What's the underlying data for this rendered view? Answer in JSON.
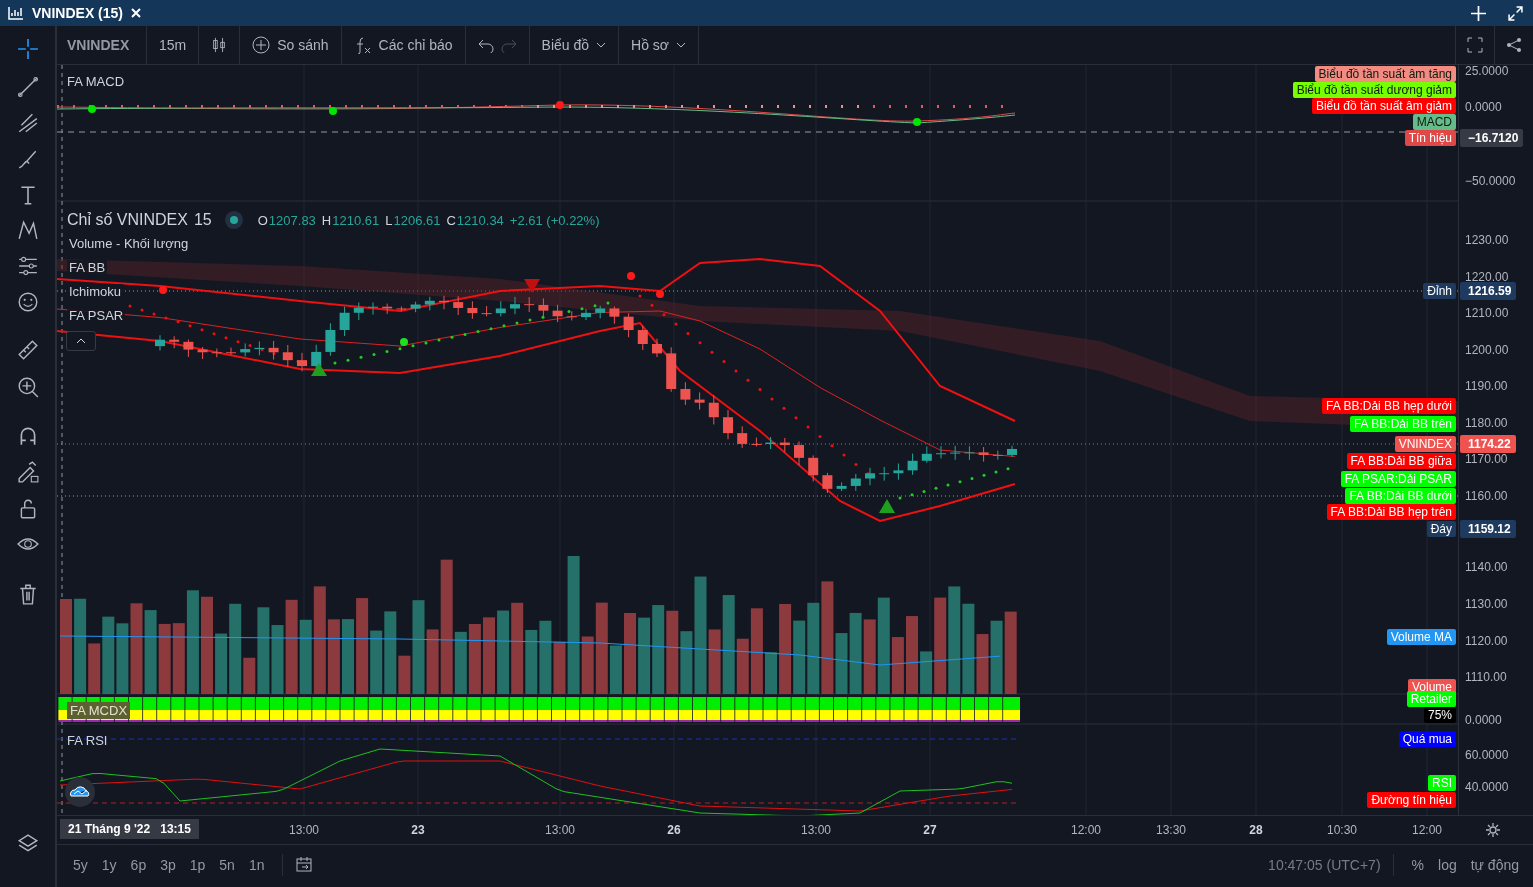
{
  "tab": {
    "title": "VNINDEX (15)"
  },
  "toolbar": {
    "symbol": "VNINDEX",
    "interval": "15m",
    "compare": "So sánh",
    "indicators": "Các chỉ báo",
    "chart_menu": "Biểu đồ",
    "profile_menu": "Hồ sơ"
  },
  "macd_pane": {
    "title": "FA MACD",
    "axis_ticks": [
      "25.0000",
      "0.0000",
      "−50.0000"
    ],
    "tags": [
      {
        "label": "Biểu đồ tần suất âm tăng",
        "color": "#f28b82"
      },
      {
        "label": "Biểu đồ tần suất dương giảm",
        "color": "#76ff03"
      },
      {
        "label": "Biểu đồ tần suất âm giảm",
        "color": "#ff0000"
      },
      {
        "label": "MACD",
        "color": "#66bb8a"
      },
      {
        "label": "Tín hiệu",
        "color": "#e04848"
      }
    ],
    "axis_labels": [
      {
        "label": "−16.7120",
        "color": "#363a45"
      }
    ]
  },
  "main_pane": {
    "symbol": "Chỉ số VNINDEX",
    "interval": "15",
    "ohlc": [
      {
        "key": "O",
        "value": "1207.83"
      },
      {
        "key": "H",
        "value": "1210.61"
      },
      {
        "key": "L",
        "value": "1206.61"
      },
      {
        "key": "C",
        "value": "1210.34"
      }
    ],
    "change": "+2.61 (+0.22%)",
    "indicators": [
      "Volume - Khối lượng",
      "FA BB",
      "Ichimoku",
      "FA PSAR"
    ],
    "axis_ticks": [
      "1230.00",
      "1220.00",
      "1210.00",
      "1200.00",
      "1190.00",
      "1180.00",
      "1170.00",
      "1160.00",
      "1140.00",
      "1130.00",
      "1120.00",
      "1110.00"
    ],
    "tags": [
      {
        "label": "Đỉnh",
        "color": "#1e3a5f"
      },
      {
        "label": "FA BB:Dải BB hẹp dưới",
        "color": "#ff0000"
      },
      {
        "label": "FA BB:Dải BB trên",
        "color": "#00ff00"
      },
      {
        "label": "VNINDEX",
        "color": "#ef5350"
      },
      {
        "label": "FA BB:Dải BB giữa",
        "color": "#ff0000"
      },
      {
        "label": "FA PSAR:Dải PSAR",
        "color": "#00ff00"
      },
      {
        "label": "FA BB:Dải BB dưới",
        "color": "#00ff00"
      },
      {
        "label": "FA BB:Dải BB hẹp trên",
        "color": "#ff0000"
      },
      {
        "label": "Đáy",
        "color": "#1e3a5f"
      },
      {
        "label": "Volume MA",
        "color": "#2196f3"
      },
      {
        "label": "Volume",
        "color": "#ef5350"
      }
    ],
    "axis_labels": [
      {
        "label": "1216.59",
        "color": "#1e3a5f"
      },
      {
        "label": "1174.22",
        "color": "#ef5350"
      },
      {
        "label": "1159.12",
        "color": "#1e3a5f"
      }
    ]
  },
  "mcdx_pane": {
    "title": "FA MCDX",
    "axis_ticks": [
      "0.0000"
    ],
    "tags": [
      {
        "label": "Retailer",
        "color": "#00ff00"
      },
      {
        "label": "75%",
        "color": "#000000"
      }
    ]
  },
  "rsi_pane": {
    "title": "FA RSI",
    "axis_ticks": [
      "60.0000",
      "40.0000"
    ],
    "tags": [
      {
        "label": "Quá mua",
        "color": "#0000ff"
      },
      {
        "label": "RSI",
        "color": "#00ff00"
      },
      {
        "label": "Đường tín hiệu",
        "color": "#ff0000"
      }
    ]
  },
  "time_axis": {
    "cursor_label": "21 Tháng 9 '22   13:15",
    "labels": [
      {
        "text": "13:00",
        "kind": "time"
      },
      {
        "text": "23",
        "kind": "day"
      },
      {
        "text": "13:00",
        "kind": "time"
      },
      {
        "text": "26",
        "kind": "day"
      },
      {
        "text": "13:00",
        "kind": "time"
      },
      {
        "text": "27",
        "kind": "day"
      },
      {
        "text": "12:00",
        "kind": "time"
      },
      {
        "text": "13:30",
        "kind": "time"
      },
      {
        "text": "28",
        "kind": "day"
      },
      {
        "text": "10:30",
        "kind": "time"
      },
      {
        "text": "12:00",
        "kind": "time"
      }
    ]
  },
  "bottom_bar": {
    "ranges": [
      "5y",
      "1y",
      "6p",
      "3p",
      "1p",
      "5n",
      "1n"
    ],
    "clock": "10:47:05 (UTC+7)",
    "percent": "%",
    "log": "log",
    "auto": "tự động"
  }
}
